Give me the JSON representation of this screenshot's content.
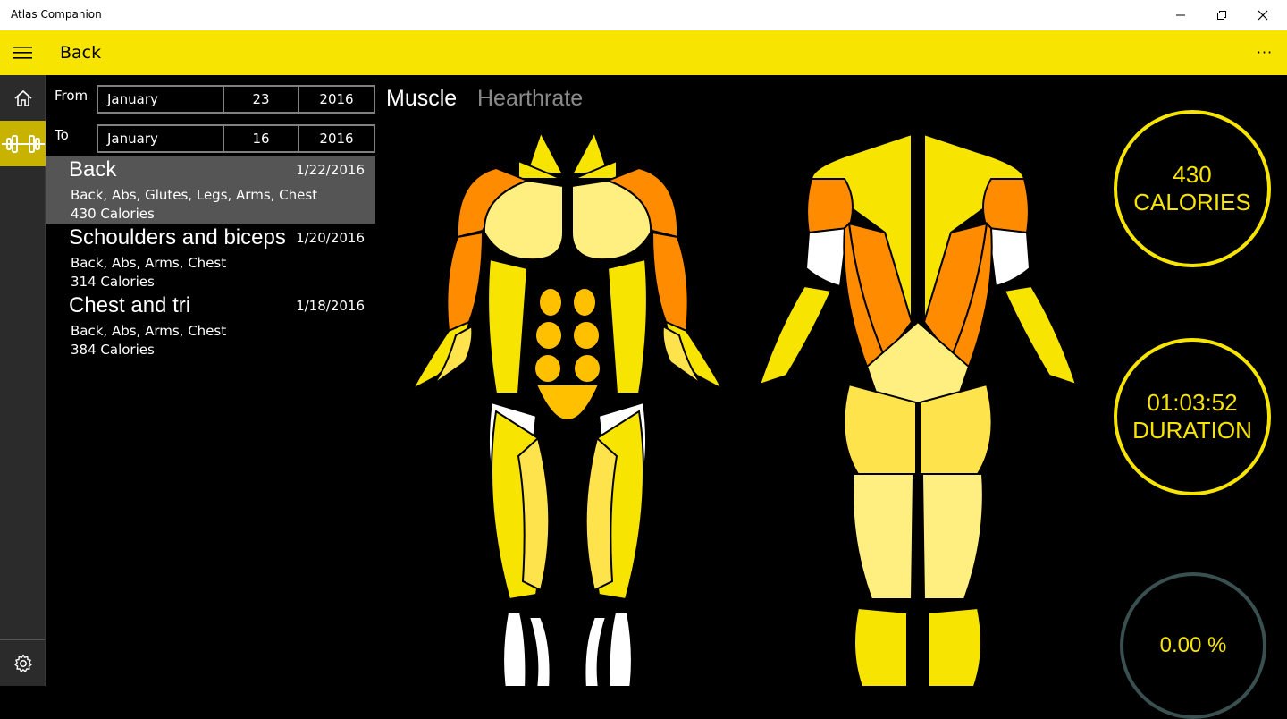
{
  "window": {
    "title": "Atlas Companion"
  },
  "header": {
    "title": "Back",
    "more_label": "···"
  },
  "filters": {
    "from_label": "From",
    "to_label": "To",
    "from": {
      "month": "January",
      "day": "23",
      "year": "2016"
    },
    "to": {
      "month": "January",
      "day": "16",
      "year": "2016"
    }
  },
  "sessions": [
    {
      "name": "Back",
      "date": "1/22/2016",
      "parts": "Back, Abs, Glutes, Legs, Arms, Chest",
      "calories": "430 Calories"
    },
    {
      "name": "Schoulders and biceps",
      "date": "1/20/2016",
      "parts": "Back, Abs, Arms, Chest",
      "calories": "314 Calories"
    },
    {
      "name": "Chest and tri",
      "date": "1/18/2016",
      "parts": "Back, Abs, Arms, Chest",
      "calories": "384 Calories"
    }
  ],
  "tabs": {
    "muscle": "Muscle",
    "heartrate": "Hearthrate"
  },
  "stats": {
    "calories_value": "430",
    "calories_label": "CALORIES",
    "duration_value": "01:03:52",
    "duration_label": "DURATION",
    "percent_value": "0.00 %"
  },
  "colors": {
    "accent": "#f7e400",
    "high": "#ff8c00",
    "medium": "#ffc000",
    "low": "#ffe34d",
    "none": "#ffffff"
  },
  "icons": {
    "home": "home-icon",
    "workout": "dumbbell-icon",
    "settings": "gear-icon",
    "menu": "hamburger-icon"
  }
}
